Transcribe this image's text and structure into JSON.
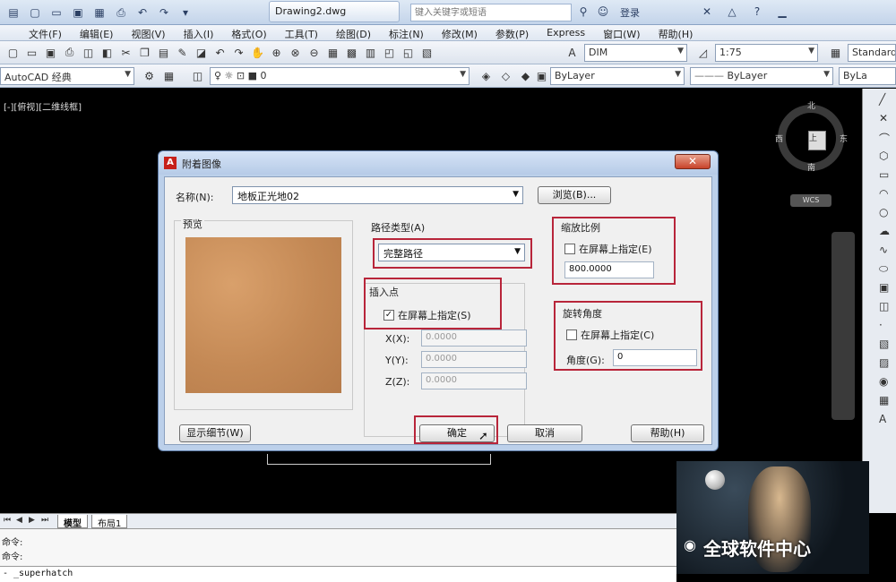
{
  "app": {
    "document_tab": "Drawing2.dwg",
    "search_placeholder": "键入关键字或短语",
    "login_label": "登录"
  },
  "menu": [
    "文件(F)",
    "编辑(E)",
    "视图(V)",
    "插入(I)",
    "格式(O)",
    "工具(T)",
    "绘图(D)",
    "标注(N)",
    "修改(M)",
    "参数(P)",
    "Express",
    "窗口(W)",
    "帮助(H)"
  ],
  "toolbar": {
    "dim_style": "DIM",
    "scale": "1:75",
    "text_style": "Standard",
    "workspace": "AutoCAD 经典",
    "layer_value": "0",
    "color_value": "ByLayer",
    "linetype_value": "ByLayer",
    "lineweight_value": "ByLa"
  },
  "viewport": {
    "label": "[-][俯视][二维线框]",
    "compass": {
      "north": "北",
      "south": "南",
      "east": "东",
      "west": "西",
      "center": "上"
    },
    "wcs": "WCS"
  },
  "dialog": {
    "title": "附着图像",
    "name_label": "名称(N):",
    "name_value": "地板正光地02",
    "browse_button": "浏览(B)...",
    "preview_label": "预览",
    "path_type_label": "路径类型(A)",
    "path_type_value": "完整路径",
    "insertion_point": {
      "label": "插入点",
      "checkbox": "在屏幕上指定(S)",
      "checked": true,
      "x_label": "X(X):",
      "x_value": "0.0000",
      "y_label": "Y(Y):",
      "y_value": "0.0000",
      "z_label": "Z(Z):",
      "z_value": "0.0000"
    },
    "scale": {
      "label": "缩放比例",
      "checkbox": "在屏幕上指定(E)",
      "checked": false,
      "value": "800.0000"
    },
    "rotation": {
      "label": "旋转角度",
      "checkbox": "在屏幕上指定(C)",
      "checked": false,
      "angle_label": "角度(G):",
      "angle_value": "0"
    },
    "details_button": "显示细节(W)",
    "ok_button": "确定",
    "cancel_button": "取消",
    "help_button": "帮助(H)"
  },
  "tabs": {
    "model": "模型",
    "layout1": "布局1"
  },
  "command": {
    "line1": "命令:",
    "line2": "命令:",
    "input": "- _superhatch"
  },
  "watermark": {
    "text": "全球软件中心"
  },
  "colors": {
    "accent_red": "#b8253a",
    "viewport_bg": "#000000",
    "dialog_frame": "#bcd0ea"
  }
}
